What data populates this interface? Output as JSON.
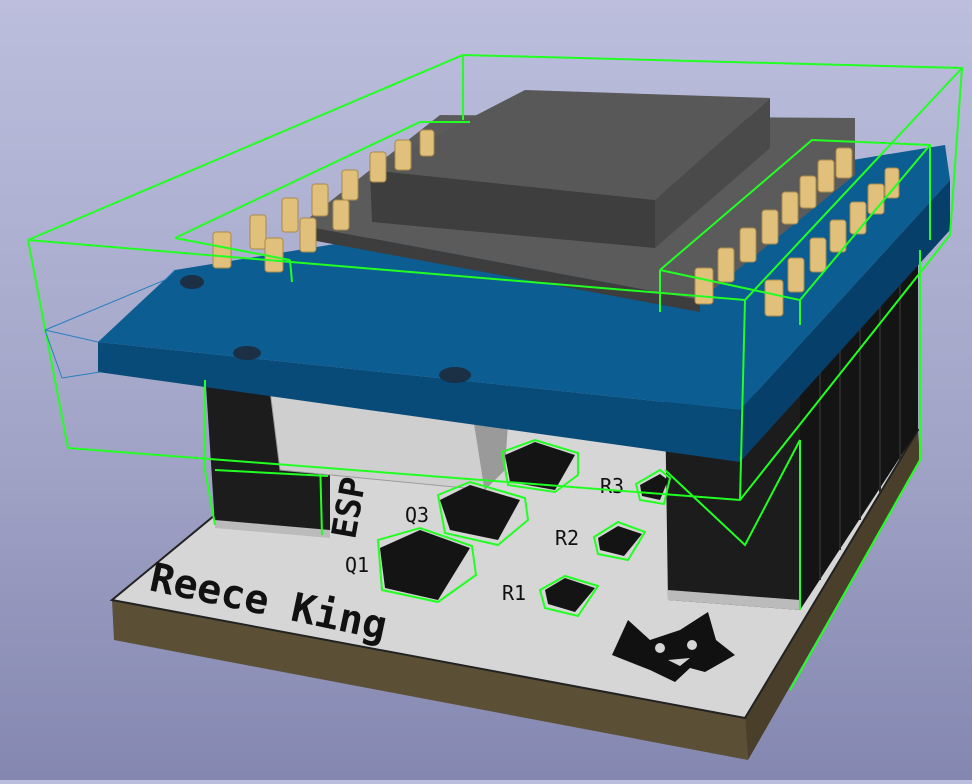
{
  "viewer": {
    "board": {
      "silkscreen_name": "Reece King",
      "module_label": "ESP",
      "designators": [
        "Q1",
        "Q3",
        "R1",
        "R2",
        "R3"
      ]
    },
    "icons": [
      "cat-logo-icon"
    ],
    "colors": {
      "background_top": "#bcbedd",
      "background_bottom": "#8487b0",
      "pcb_white": "#d6d6d6",
      "pcb_edge": "#5b4f36",
      "module_blue": "#0a5a8d",
      "header_black": "#1c1c1c",
      "pin_gold": "#e0c07a",
      "bbox_green": "#22ff22",
      "esp_shield": "#555555"
    }
  }
}
